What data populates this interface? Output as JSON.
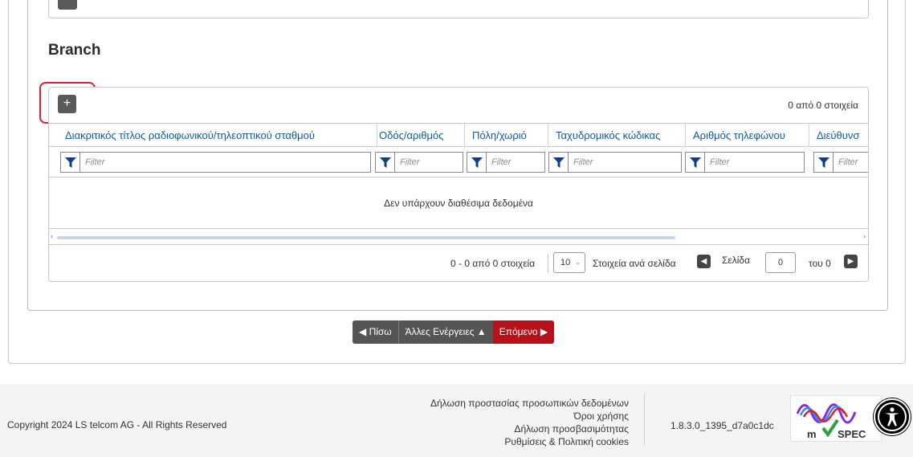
{
  "branch_section": {
    "title": "Branch",
    "add_label": "+",
    "count": "0 από 0 στοιχεία"
  },
  "grid": {
    "columns": [
      "Διακριτικός τίτλος ραδιοφωνικού/τηλεοπτικού σταθμού",
      "Οδός/αριθμός",
      "Πόλη/χωριό",
      "Ταχυδρομικός κώδικας",
      "Αριθμός τηλεφώνου",
      "Διεύθυνσ"
    ],
    "filter_placeholder": "Filter",
    "empty_message": "Δεν υπάρχουν διαθέσιμα δεδομένα"
  },
  "pager": {
    "info": "0 - 0 από 0 στοιχεία",
    "page_size": "10",
    "per_page_label": "Στοιχεία ανά σελίδα",
    "page_label": "Σελίδα",
    "page_value": "0",
    "of_label": "του 0"
  },
  "actions": {
    "back": "◀ Πίσω",
    "more": "Άλλες Ενέργειες ▲",
    "next": "Επόμενο ▶"
  },
  "footer": {
    "copyright": "Copyright 2024 LS telcom AG - All Rights Reserved",
    "links": [
      "Δήλωση προστασίας προσωπικών δεδομένων",
      "Όροι χρήσης",
      "Δήλωση προσβασιμότητας",
      "Ρυθμίσεις & Πολιτική cookies"
    ],
    "version": "1.8.3.0_1395_d7a0c1dc",
    "logo_text": "mySPEC"
  },
  "colors": {
    "header_text": "#0f5a9e",
    "next_button": "#b5121b",
    "highlight": "#d9202c"
  }
}
